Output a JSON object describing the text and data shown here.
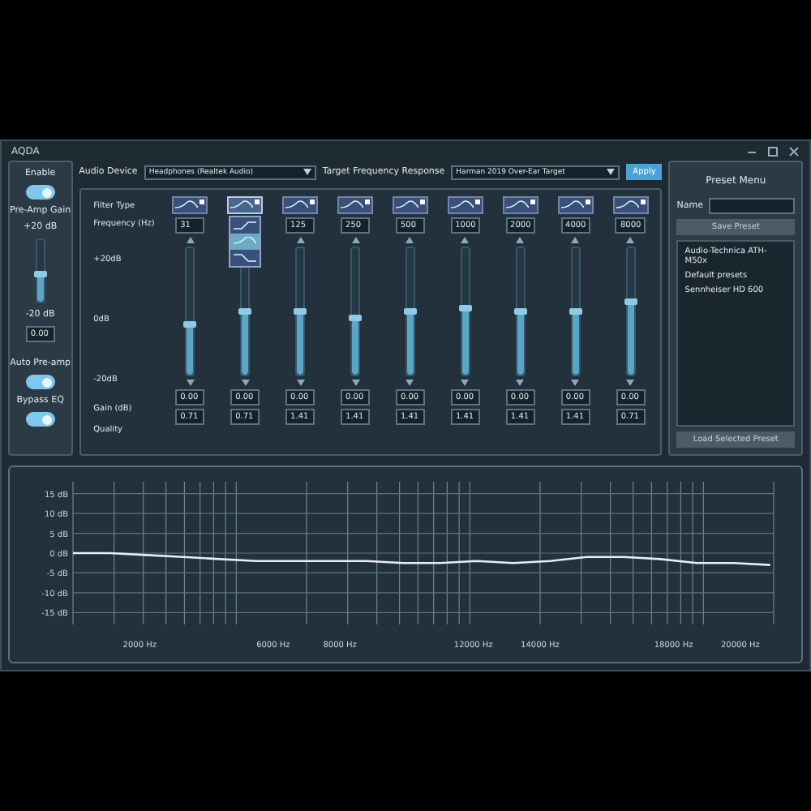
{
  "window": {
    "title": "AQDA"
  },
  "left_panel": {
    "controls": [
      {
        "kind": "toggle",
        "label": "Enable",
        "on": true
      },
      {
        "kind": "slider",
        "label": "Pre-Amp Gain",
        "top": "+20 dB",
        "bottom": "-20 dB",
        "level": 0.45,
        "value": "0.00"
      },
      {
        "kind": "toggle",
        "label": "Auto Pre-amp",
        "on": true
      },
      {
        "kind": "toggle",
        "label": "Bypass EQ",
        "on": true
      }
    ]
  },
  "toolbar": {
    "device_label": "Audio Device",
    "device_value": "Headphones (Realtek Audio)",
    "target_label": "Target Frequency Response",
    "target_value": "Harman 2019 Over-Ear Target",
    "apply": "Apply"
  },
  "eq": {
    "row_labels": {
      "filter": "Filter Type",
      "frequency": "Frequency (Hz)",
      "top": "+20dB",
      "middle": "0dB",
      "bottom": "-20dB",
      "gain": "Gain (dB)",
      "quality": "Quality"
    },
    "bands": [
      {
        "frequency": "31",
        "level": 0.4,
        "gain": "0.00",
        "quality": "0.71",
        "expanded": false
      },
      {
        "level": 0.5,
        "gain": "0.00",
        "quality": "0.71",
        "expanded": true,
        "options": [
          {
            "selected": false
          },
          {
            "selected": true
          },
          {
            "selected": false
          }
        ]
      },
      {
        "frequency": "125",
        "level": 0.5,
        "gain": "0.00",
        "quality": "1.41",
        "expanded": false
      },
      {
        "frequency": "250",
        "level": 0.45,
        "gain": "0.00",
        "quality": "1.41",
        "expanded": false
      },
      {
        "frequency": "500",
        "level": 0.5,
        "gain": "0.00",
        "quality": "1.41",
        "expanded": false
      },
      {
        "frequency": "1000",
        "level": 0.52,
        "gain": "0.00",
        "quality": "1.41",
        "expanded": false
      },
      {
        "frequency": "2000",
        "level": 0.5,
        "gain": "0.00",
        "quality": "1.41",
        "expanded": false
      },
      {
        "frequency": "4000",
        "level": 0.5,
        "gain": "0.00",
        "quality": "1.41",
        "expanded": false
      },
      {
        "frequency": "8000",
        "level": 0.58,
        "gain": "0.00",
        "quality": "0.71",
        "expanded": false
      }
    ]
  },
  "preset_menu": {
    "title": "Preset Menu",
    "name_label": "Name",
    "save": "Save Preset",
    "items": [
      {
        "label": "Audio-Technica ATH-M50x",
        "selected": false
      },
      {
        "label": "Default presets",
        "selected": false
      },
      {
        "label": "Sennheiser HD 600",
        "selected": false
      }
    ],
    "load": "Load Selected Preset"
  },
  "chart_data": {
    "type": "line",
    "grid": true,
    "xlim": [
      0,
      21000
    ],
    "ylim": [
      -18,
      18
    ],
    "yticks": [
      {
        "value": 15,
        "label": "15 dB"
      },
      {
        "value": 10,
        "label": "10 dB"
      },
      {
        "value": 5,
        "label": "5 dB"
      },
      {
        "value": 0,
        "label": "0 dB"
      },
      {
        "value": -5,
        "label": "-5 dB"
      },
      {
        "value": -10,
        "label": "-10 dB"
      },
      {
        "value": -15,
        "label": "-15 dB"
      }
    ],
    "xticks": [
      {
        "value": 2000,
        "label": "2000 Hz"
      },
      {
        "value": 6000,
        "label": "6000 Hz"
      },
      {
        "value": 8000,
        "label": "8000 Hz"
      },
      {
        "value": 12000,
        "label": "12000 Hz"
      },
      {
        "value": 14000,
        "label": "14000 Hz"
      },
      {
        "value": 18000,
        "label": "18000 Hz"
      },
      {
        "value": 20000,
        "label": "20000 Hz"
      }
    ],
    "x": [
      0,
      1100,
      2200,
      3300,
      4400,
      5500,
      6600,
      7700,
      8800,
      9900,
      11000,
      12100,
      13200,
      14300,
      15400,
      16500,
      17600,
      18700,
      19800,
      20900
    ],
    "series": [
      {
        "color": "#e8eef2",
        "values": [
          0,
          0,
          -0.5,
          -1,
          -1.5,
          -2,
          -2,
          -2,
          -2,
          -2.5,
          -2.5,
          -2,
          -2.5,
          -2,
          -1,
          -1,
          -1.5,
          -2.5,
          -2.5,
          -3
        ]
      }
    ]
  }
}
